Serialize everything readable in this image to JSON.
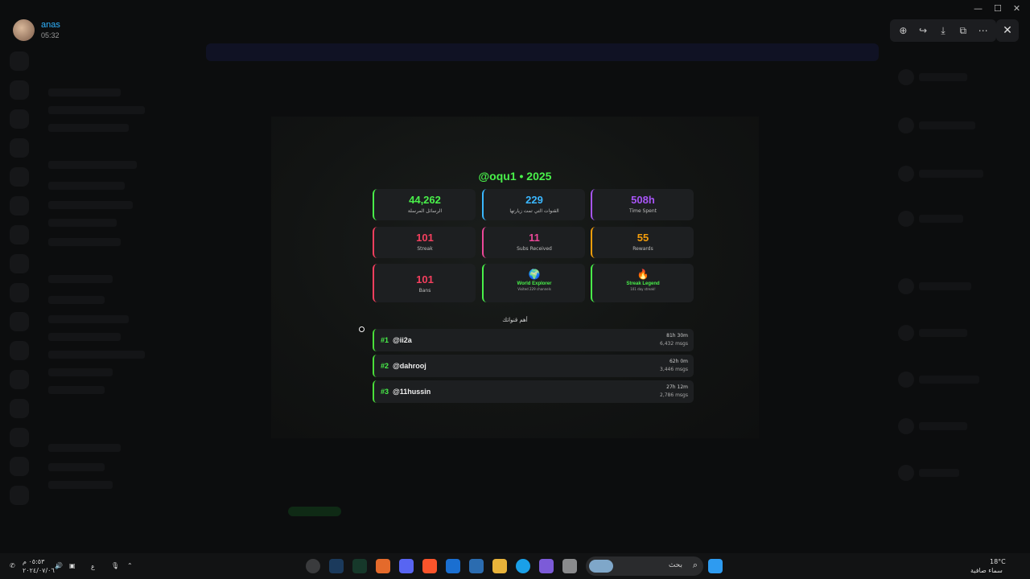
{
  "user": {
    "name": "anas",
    "time": "05:32"
  },
  "viewer": {
    "tools": [
      {
        "icon": "zoom-in-icon",
        "glyph": "⊕"
      },
      {
        "icon": "share-icon",
        "glyph": "↪"
      },
      {
        "icon": "download-icon",
        "glyph": "⤓"
      },
      {
        "icon": "open-external-icon",
        "glyph": "⧉"
      },
      {
        "icon": "more-icon",
        "glyph": "⋯"
      }
    ],
    "close_glyph": "✕"
  },
  "window_controls": {
    "minimize": "—",
    "maximize": "☐",
    "close": "✕"
  },
  "card": {
    "title": "@oqu1 • 2025",
    "stats": [
      {
        "value": "44,262",
        "label": "الرسائل المرسلة",
        "color": "#49f04a"
      },
      {
        "value": "229",
        "label": "القنوات التي تمت زيارتها",
        "color": "#3ab7ff"
      },
      {
        "value": "508h",
        "label": "Time Spent",
        "color": "#a855f7"
      },
      {
        "value": "101",
        "label": "Streak",
        "color": "#f43f5e"
      },
      {
        "value": "11",
        "label": "Subs Received",
        "color": "#ec4899"
      },
      {
        "value": "55",
        "label": "Rewards",
        "color": "#f59e0b"
      },
      {
        "value": "101",
        "label": "Bans",
        "color": "#f43f5e"
      }
    ],
    "badges": [
      {
        "icon": "globe-icon",
        "glyph": "🌍",
        "title": "World Explorer",
        "sub": "Visited 229 channels"
      },
      {
        "icon": "fire-icon",
        "glyph": "🔥",
        "title": "Streak Legend",
        "sub": "101 day streak!"
      }
    ],
    "top_label": "أهم قنواتك",
    "channels": [
      {
        "rank": "#1",
        "name": "@ii2a",
        "time": "81h 30m",
        "msgs": "6,432 msgs"
      },
      {
        "rank": "#2",
        "name": "@dahrooj",
        "time": "62h 0m",
        "msgs": "3,446 msgs"
      },
      {
        "rank": "#3",
        "name": "@11hussin",
        "time": "27h 12m",
        "msgs": "2,786 msgs"
      }
    ]
  },
  "taskbar": {
    "search_placeholder": "بحث",
    "weather_temp": "18°C",
    "weather_desc": "سماء صافية",
    "clock_time": "٠٥:٥٣ م",
    "clock_date": "٢٠٢٤/٠٧/٠٦",
    "lang": "ع",
    "colors": {
      "brave": "#fb542b",
      "discord": "#5865f2",
      "edge": "#1aa0e8",
      "start": "#2e9bf0"
    }
  }
}
